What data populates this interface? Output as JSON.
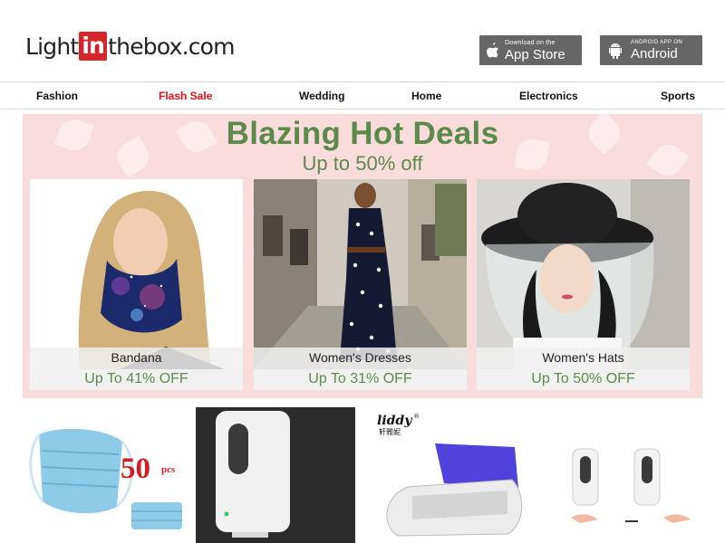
{
  "header": {
    "logo_pre": "Light",
    "logo_in": "in",
    "logo_post": "thebox.com",
    "app_store": {
      "small": "Download on the",
      "big": "App Store",
      "icon": "apple-icon"
    },
    "android": {
      "small": "ANDROID APP ON",
      "big": "Android",
      "icon": "android-icon"
    }
  },
  "nav": {
    "items": [
      {
        "label": "Fashion"
      },
      {
        "label": "Flash Sale",
        "highlight": "#e5101d"
      },
      {
        "label": "Wedding"
      },
      {
        "label": "Home"
      },
      {
        "label": "Electronics"
      },
      {
        "label": "Sports"
      }
    ]
  },
  "banner": {
    "title": "Blazing Hot Deals",
    "subtitle": "Up to 50% off",
    "colors": {
      "background": "#fbdcdc",
      "text": "#5c8a4a"
    },
    "cards": [
      {
        "name": "Bandana",
        "offer": "Up To 41% OFF"
      },
      {
        "name": "Women's Dresses",
        "offer": "Up To 31% OFF"
      },
      {
        "name": "Women's Hats",
        "offer": "Up To 50% OFF"
      }
    ]
  },
  "products": {
    "masks": {
      "badge": "50",
      "unit": "pcs"
    },
    "sterilizer": {
      "brand": "liddy",
      "brand_mark": "®",
      "brand_cn": "轩雅妮"
    }
  }
}
